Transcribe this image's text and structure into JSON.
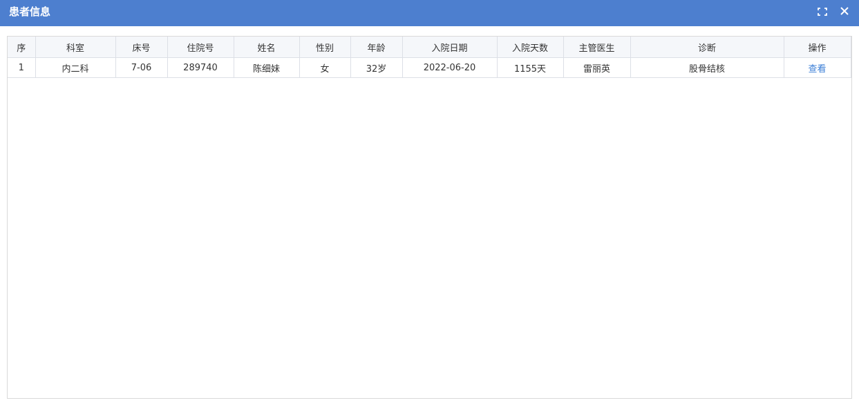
{
  "dialog": {
    "title": "患者信息",
    "maximize_icon": "maximize-icon",
    "close_icon": "close-icon"
  },
  "table": {
    "headers": {
      "index": "序",
      "department": "科室",
      "bed": "床号",
      "admission_no": "住院号",
      "name": "姓名",
      "sex": "性别",
      "age": "年龄",
      "admission_date": "入院日期",
      "days": "入院天数",
      "doctor": "主管医生",
      "diagnosis": "诊断",
      "action": "操作"
    },
    "rows": [
      {
        "index": "1",
        "department": "内二科",
        "bed": "7-06",
        "admission_no": "289740",
        "name": "陈细妹",
        "sex": "女",
        "age": "32岁",
        "admission_date": "2022-06-20",
        "days": "1155天",
        "doctor": "雷丽英",
        "diagnosis": "股骨结核",
        "action": "查看"
      }
    ]
  },
  "colors": {
    "titlebar": "#4d7fcf",
    "link": "#3a7ed6"
  }
}
